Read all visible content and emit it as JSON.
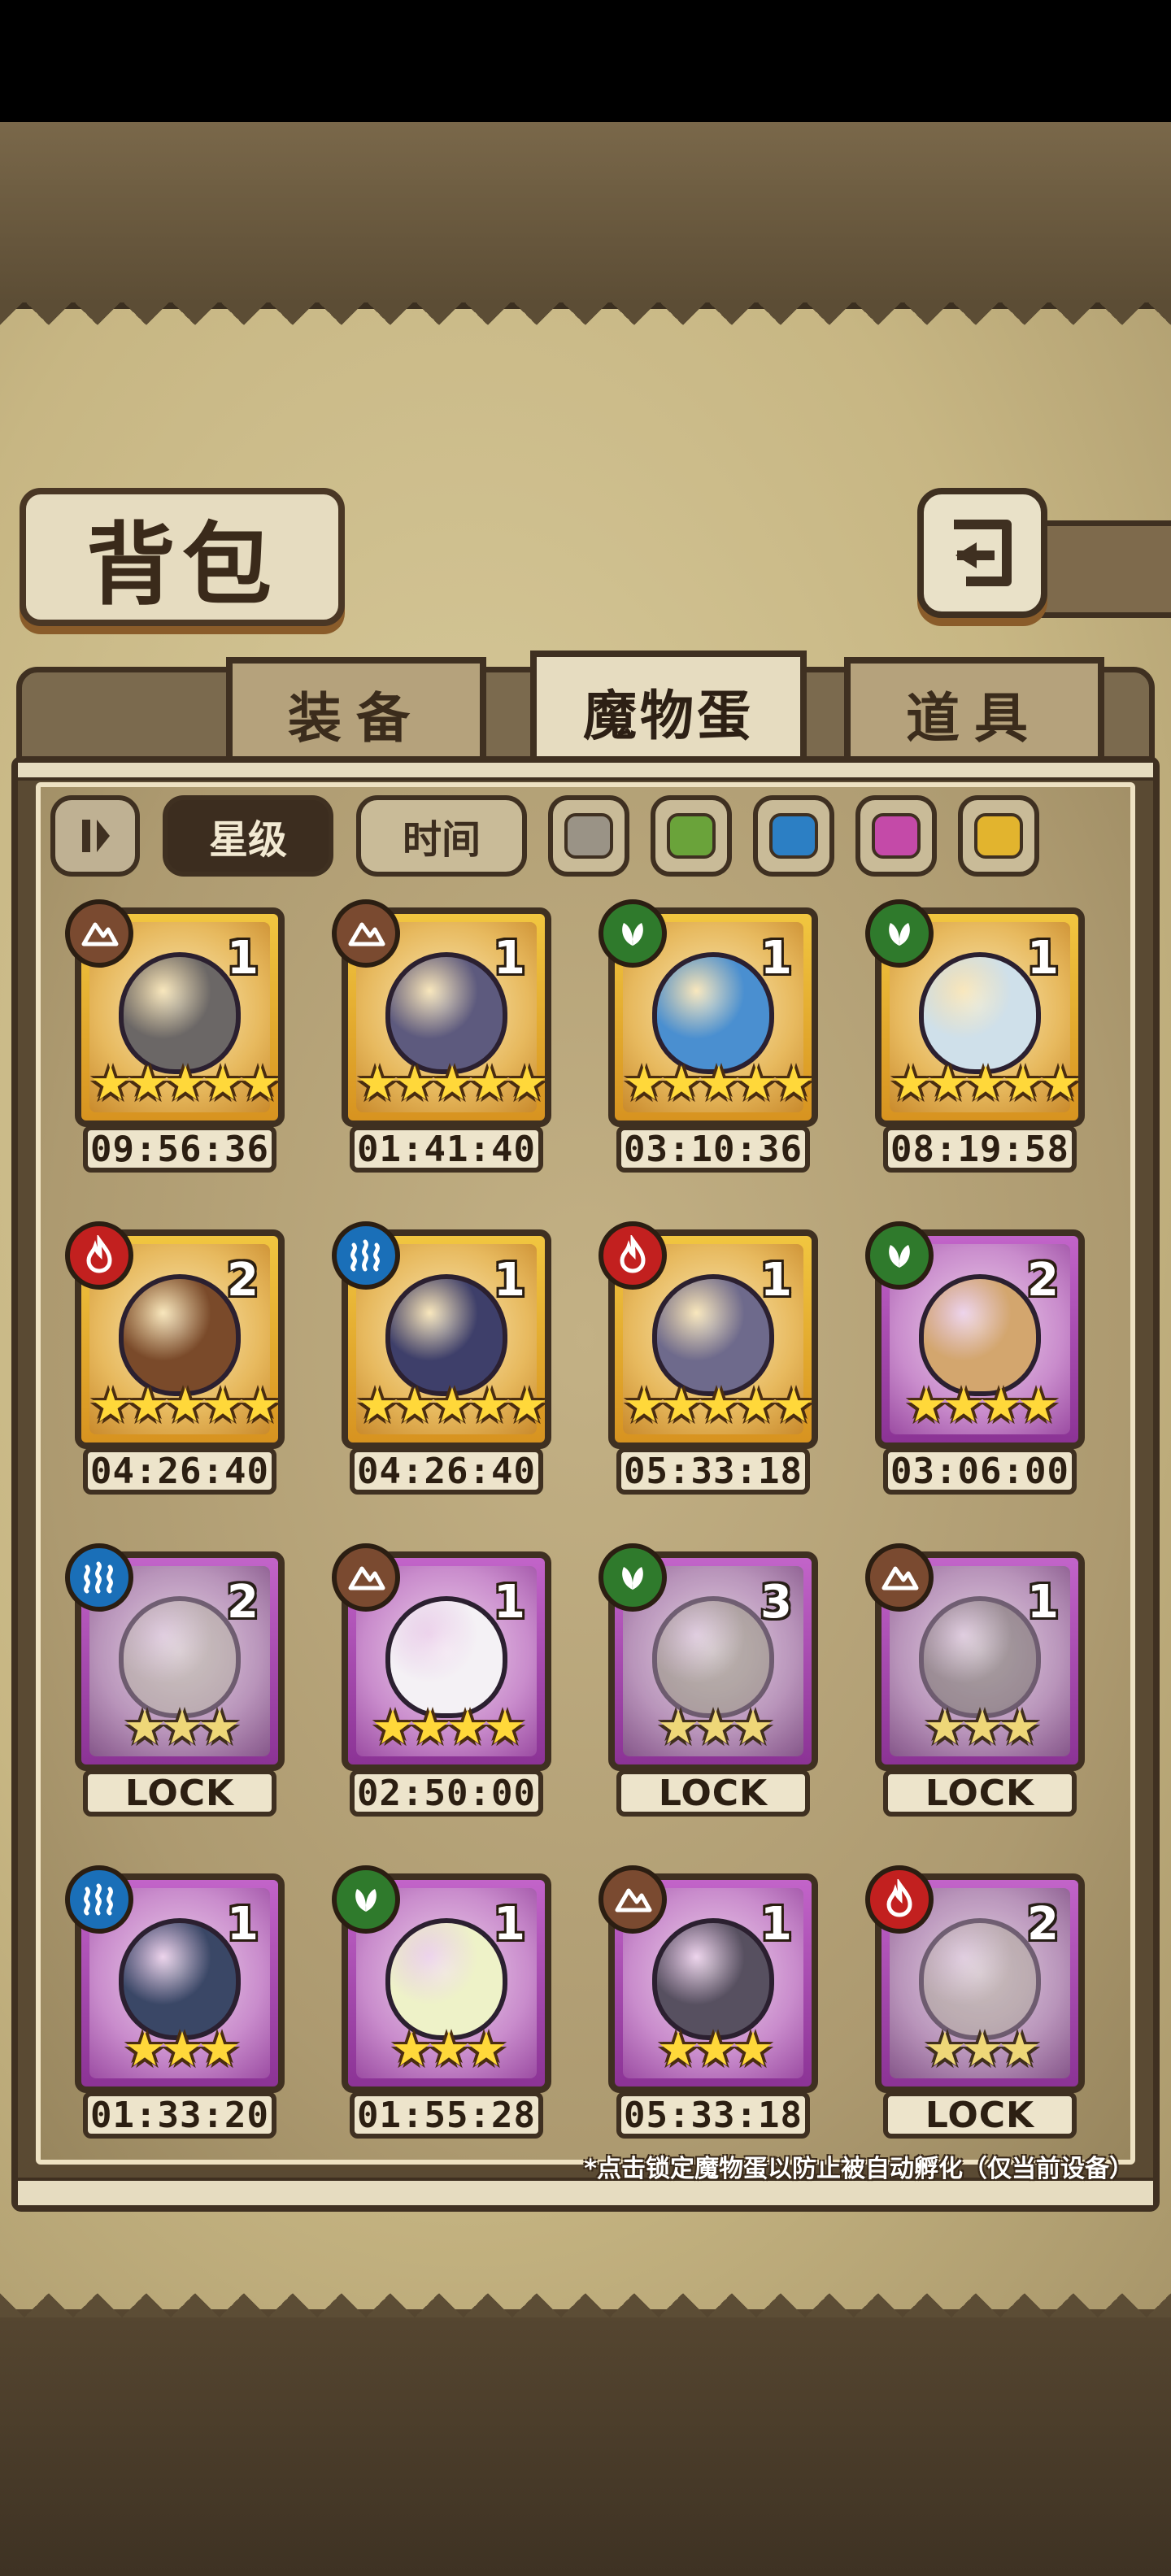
{
  "header": {
    "title": "背包"
  },
  "tabs": [
    {
      "label": "装备",
      "active": false
    },
    {
      "label": "魔物蛋",
      "active": true
    },
    {
      "label": "道具",
      "active": false
    }
  ],
  "filters": {
    "sort_star_label": "星级",
    "sort_time_label": "时间",
    "sort_selected": "星级",
    "color_swatches": [
      "#9a9386",
      "#6aa33a",
      "#2c7fc4",
      "#c44aa8",
      "#e2b42e"
    ]
  },
  "eggs": [
    {
      "element": "earth",
      "rarity": "gold",
      "count": "1",
      "stars": "★★★★★",
      "timer": "09:56:36",
      "locked": false,
      "egg_color": "#6b6766"
    },
    {
      "element": "earth",
      "rarity": "gold",
      "count": "1",
      "stars": "★★★★★",
      "timer": "01:41:40",
      "locked": false,
      "egg_color": "#5d5a7e"
    },
    {
      "element": "nature",
      "rarity": "gold",
      "count": "1",
      "stars": "★★★★★",
      "timer": "03:10:36",
      "locked": false,
      "egg_color": "#4a8fd0"
    },
    {
      "element": "nature",
      "rarity": "gold",
      "count": "1",
      "stars": "★★★★★",
      "timer": "08:19:58",
      "locked": false,
      "egg_color": "#cfe0ea"
    },
    {
      "element": "fire",
      "rarity": "gold",
      "count": "2",
      "stars": "★★★★★",
      "timer": "04:26:40",
      "locked": false,
      "egg_color": "#7a4a2a"
    },
    {
      "element": "water",
      "rarity": "gold",
      "count": "1",
      "stars": "★★★★★",
      "timer": "04:26:40",
      "locked": false,
      "egg_color": "#3e3f6a"
    },
    {
      "element": "fire",
      "rarity": "gold",
      "count": "1",
      "stars": "★★★★★",
      "timer": "05:33:18",
      "locked": false,
      "egg_color": "#6e6a8c"
    },
    {
      "element": "nature",
      "rarity": "purple",
      "count": "2",
      "stars": "★★★★",
      "timer": "03:06:00",
      "locked": false,
      "egg_color": "#d3a66e"
    },
    {
      "element": "water",
      "rarity": "purple",
      "count": "2",
      "stars": "★★★",
      "timer": "LOCK",
      "locked": true,
      "egg_color": "#b9b39a"
    },
    {
      "element": "earth",
      "rarity": "purple",
      "count": "1",
      "stars": "★★★★",
      "timer": "02:50:00",
      "locked": false,
      "egg_color": "#f4f1f5"
    },
    {
      "element": "nature",
      "rarity": "purple",
      "count": "3",
      "stars": "★★★",
      "timer": "LOCK",
      "locked": true,
      "egg_color": "#9a9a74"
    },
    {
      "element": "earth",
      "rarity": "purple",
      "count": "1",
      "stars": "★★★",
      "timer": "LOCK",
      "locked": true,
      "egg_color": "#7a7566"
    },
    {
      "element": "water",
      "rarity": "purple",
      "count": "1",
      "stars": "★★★",
      "timer": "01:33:20",
      "locked": false,
      "egg_color": "#3a4766"
    },
    {
      "element": "nature",
      "rarity": "purple",
      "count": "1",
      "stars": "★★★",
      "timer": "01:55:28",
      "locked": false,
      "egg_color": "#eef2c8"
    },
    {
      "element": "earth",
      "rarity": "purple",
      "count": "1",
      "stars": "★★★",
      "timer": "05:33:18",
      "locked": false,
      "egg_color": "#575060"
    },
    {
      "element": "fire",
      "rarity": "purple",
      "count": "2",
      "stars": "★★★",
      "timer": "LOCK",
      "locked": true,
      "egg_color": "#b5aa94"
    }
  ],
  "footnote": "*点击锁定魔物蛋以防止被自动孵化（仅当前设备）"
}
